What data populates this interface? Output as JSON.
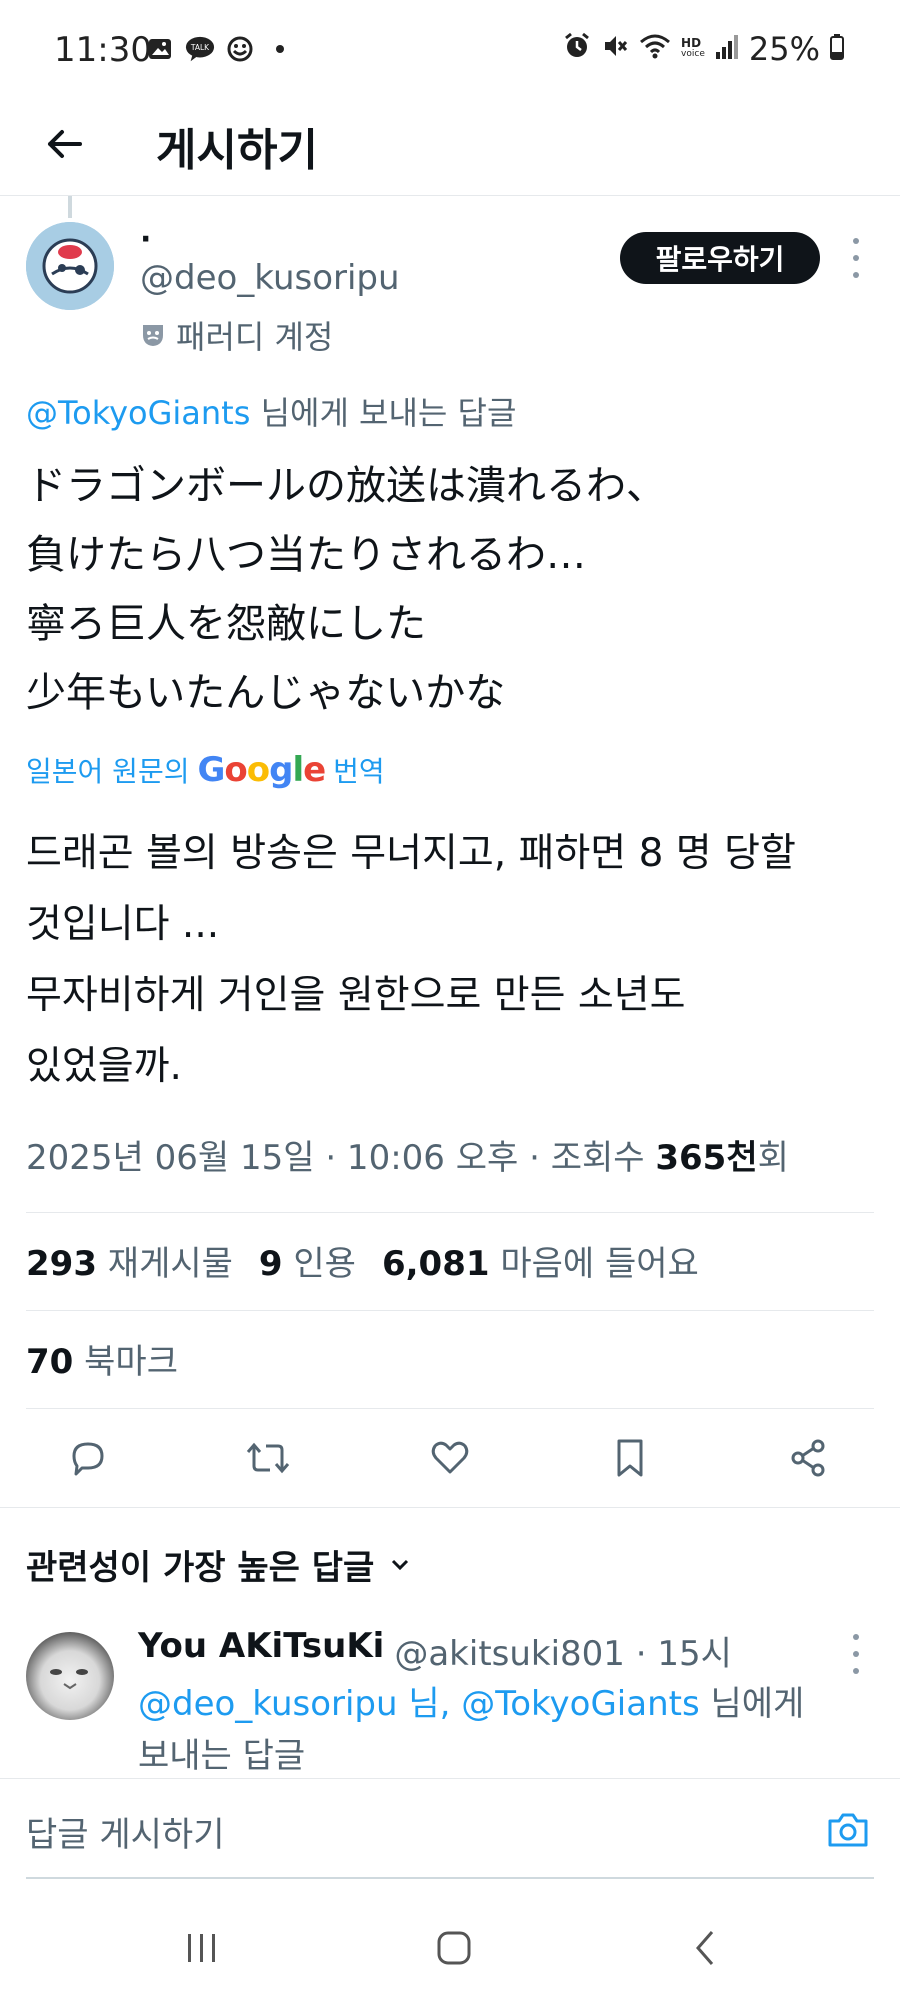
{
  "status_bar": {
    "time": "11:30",
    "left_icons": [
      "gallery-icon",
      "kakaotalk-icon",
      "smile-icon",
      "dot-icon"
    ],
    "kakao_label": "TALK",
    "battery": "25%",
    "hd_label": "HD",
    "voice_label": "voice"
  },
  "header": {
    "title": "게시하기"
  },
  "tweet": {
    "author_name": "·",
    "author_handle": "@deo_kusoripu",
    "parody_label": "패러디 계정",
    "follow_label": "팔로우하기",
    "reply_to_mention": "@TokyoGiants",
    "reply_to_suffix": " 님에게 보내는 답글",
    "text_lines": [
      "ドラゴンボールの放送は潰れるわ、",
      "負けたら八つ当たりされるわ…",
      "寧ろ巨人を怨敵にした",
      "少年もいたんじゃないかな"
    ],
    "translate_prefix": "일본어 원문의",
    "translate_suffix": "번역",
    "translated_lines": [
      "드래곤 볼의 방송은 무너지고, 패하면 8 명 당할",
      "것입니다 ...",
      "무자비하게 거인을 원한으로 만든 소년도",
      "있었을까."
    ],
    "timestamp": "2025년 06월 15일 · 10:06 오후 · 조회수 ",
    "views_bold": "365천",
    "views_suffix": "회"
  },
  "stats": {
    "retweets_count": "293",
    "retweets_label": "재게시물",
    "quotes_count": "9",
    "quotes_label": "인용",
    "likes_count": "6,081",
    "likes_label": "마음에 들어요",
    "bookmarks_count": "70",
    "bookmarks_label": "북마크"
  },
  "replies_section": {
    "sort_label": "관련성이 가장 높은 답글"
  },
  "reply": {
    "name": "You AKiTsuKi",
    "handle_time": "@akitsuki801 · 15시",
    "mentions": "@deo_kusoripu 님, @TokyoGiants",
    "suffix_line1": " 님에게",
    "line2": "보내는 답글"
  },
  "compose": {
    "placeholder": "답글 게시하기"
  },
  "colors": {
    "accent": "#1d9bf0",
    "text_primary": "#0f1419",
    "text_secondary": "#536471",
    "divider": "#e6e9ec"
  }
}
